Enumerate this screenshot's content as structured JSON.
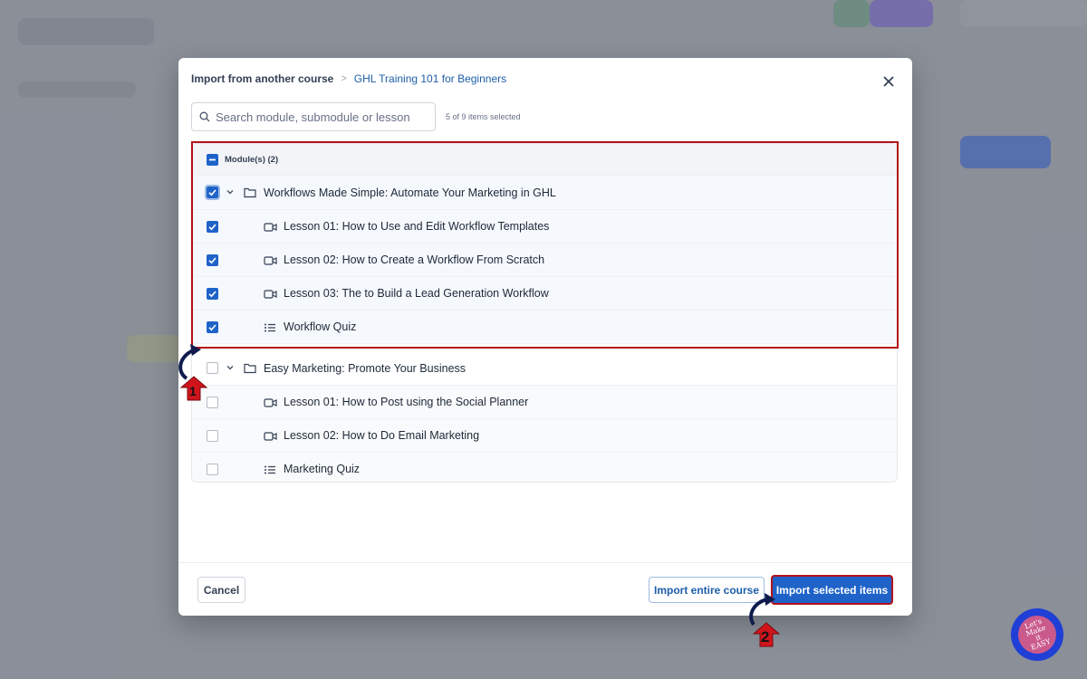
{
  "modal": {
    "breadcrumb_root": "Import from another course",
    "breadcrumb_separator": ">",
    "breadcrumb_current": "GHL Training 101 for Beginners",
    "close_icon": "close-icon"
  },
  "search": {
    "placeholder": "Search module, submodule or lesson",
    "selection_count": "5 of 9 items selected"
  },
  "list": {
    "header_label": "Module(s) (2)",
    "modules": [
      {
        "title": "Workflows Made Simple: Automate Your Marketing in GHL",
        "checked": true,
        "items": [
          {
            "title": "Lesson 01: How to Use and Edit Workflow Templates",
            "icon": "video-icon",
            "checked": true
          },
          {
            "title": "Lesson 02: How to Create a Workflow From Scratch",
            "icon": "video-icon",
            "checked": true
          },
          {
            "title": "Lesson 03: The to Build a Lead Generation Workflow",
            "icon": "video-icon",
            "checked": true
          },
          {
            "title": "Workflow Quiz",
            "icon": "quiz-list-icon",
            "checked": true
          }
        ]
      },
      {
        "title": "Easy Marketing: Promote Your Business",
        "checked": false,
        "items": [
          {
            "title": "Lesson 01: How to Post using the Social Planner",
            "icon": "video-icon",
            "checked": false
          },
          {
            "title": "Lesson 02: How to Do Email Marketing",
            "icon": "video-icon",
            "checked": false
          },
          {
            "title": "Marketing Quiz",
            "icon": "quiz-list-icon",
            "checked": false
          }
        ]
      }
    ]
  },
  "footer": {
    "cancel_label": "Cancel",
    "import_entire_label": "Import entire course",
    "import_selected_label": "Import selected items"
  },
  "annotations": {
    "step1": "1",
    "step2": "2",
    "badge_line1": "Let's Make",
    "badge_line2": "it",
    "badge_line3": "EASY"
  },
  "colors": {
    "accent": "#1f63c9",
    "highlight": "#b3121b",
    "link": "#1d5ea8"
  }
}
